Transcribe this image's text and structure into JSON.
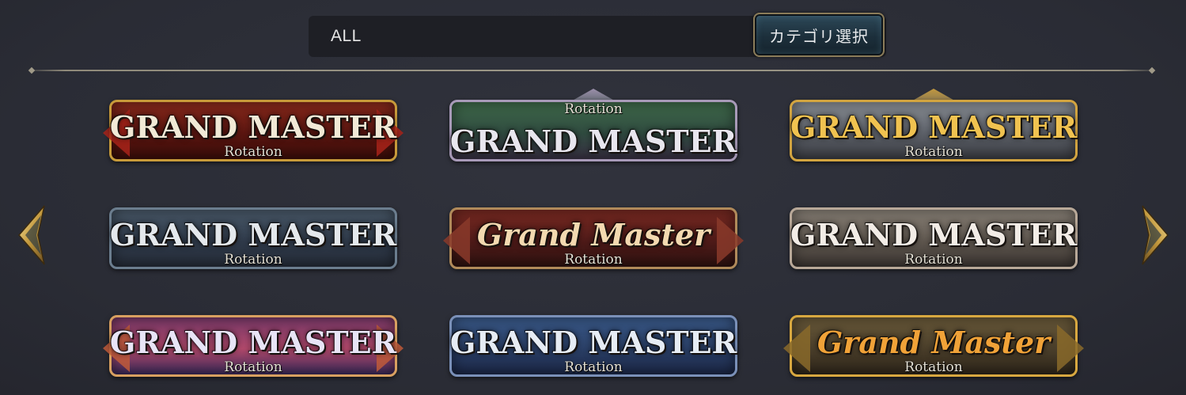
{
  "filter": {
    "value": "ALL",
    "category_button_label": "カテゴリ選択"
  },
  "badges": [
    {
      "title": "GRAND MASTER",
      "subtitle": "Rotation",
      "colors": {
        "c1": "#8a2a1c",
        "c2": "#5a1510",
        "c3": "#3a0d09",
        "trim": "#c79a3a",
        "accent": "#a8231a",
        "text": "#f1e9d6"
      }
    },
    {
      "title": "GRAND MASTER",
      "subtitle": "Rotation",
      "colors": {
        "c1": "#3f6a4a",
        "c2": "#2f4a3f",
        "c3": "#3a3245",
        "trim": "#a89ab8",
        "accent": "#6a5a7a",
        "text": "#e8e6ee"
      }
    },
    {
      "title": "GRAND MASTER",
      "subtitle": "Rotation",
      "colors": {
        "c1": "#8a8f96",
        "c2": "#5c6068",
        "c3": "#3a3c42",
        "trim": "#d2a440",
        "accent": "#7a7e86",
        "text": "#f0c250"
      }
    },
    {
      "title": "GRAND MASTER",
      "subtitle": "Rotation",
      "colors": {
        "c1": "#4a5a6a",
        "c2": "#2f3a4a",
        "c3": "#252c38",
        "trim": "#6b7d8e",
        "accent": "#5a6f3a",
        "text": "#e4e8ec"
      }
    },
    {
      "title": "Grand Master",
      "subtitle": "Rotation",
      "colors": {
        "c1": "#7a2a22",
        "c2": "#4e1a18",
        "c3": "#2e1210",
        "trim": "#b08a5a",
        "accent": "#8a3a2a",
        "text": "#f3d9b0"
      }
    },
    {
      "title": "GRAND MASTER",
      "subtitle": "Rotation",
      "colors": {
        "c1": "#8a8278",
        "c2": "#5e564e",
        "c3": "#3c3632",
        "trim": "#b8a898",
        "accent": "#6e6058",
        "text": "#f2ece6"
      }
    },
    {
      "title": "GRAND MASTER",
      "subtitle": "Rotation",
      "colors": {
        "c1": "#7a3a6a",
        "c2": "#b0486a",
        "c3": "#3a2a5a",
        "trim": "#d8a060",
        "accent": "#c05a3a",
        "text": "#e8e4f6"
      }
    },
    {
      "title": "GRAND MASTER",
      "subtitle": "Rotation",
      "colors": {
        "c1": "#3a5a8a",
        "c2": "#2a3f66",
        "c3": "#1c2848",
        "trim": "#7a90b8",
        "accent": "#3a4f7a",
        "text": "#e6ecf4"
      }
    },
    {
      "title": "Grand Master",
      "subtitle": "Rotation",
      "colors": {
        "c1": "#6a5a3a",
        "c2": "#4a3e2a",
        "c3": "#2e261a",
        "trim": "#d8a840",
        "accent": "#8a6a2a",
        "text": "#f0a238"
      }
    }
  ],
  "icons": {
    "prev": "chevron-left-icon",
    "next": "chevron-right-icon"
  }
}
